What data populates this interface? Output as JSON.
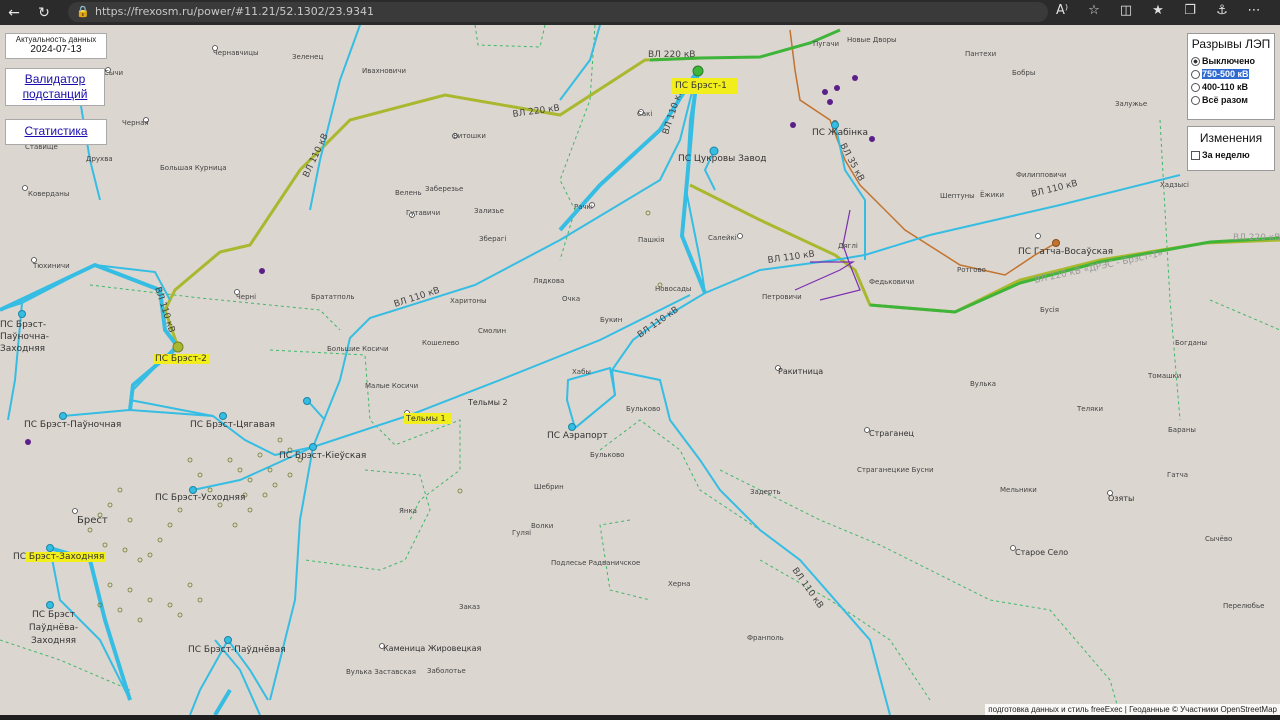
{
  "browser": {
    "url": "https://frexosm.ru/power/#11.21/52.1302/23.9341",
    "icons": [
      "back-arrow-icon",
      "reload-icon",
      "lock-icon",
      "read-aloud-icon",
      "favorite-star-icon",
      "split-screen-icon",
      "favorites-icon",
      "collections-icon",
      "extension-icon",
      "more-icon"
    ]
  },
  "info": {
    "freshness_label": "Актуальность данных",
    "freshness_date": "2024-07-13",
    "validator_link": "Валидатор подстанций",
    "stats_link": "Статистика"
  },
  "legend": {
    "title": "Разрывы ЛЭП",
    "options": [
      "Выключено",
      "750-500 кВ",
      "400-110 кВ",
      "Всё разом"
    ],
    "selected": "Выключено",
    "highlighted": "750-500 кВ"
  },
  "changes": {
    "title": "Изменения",
    "week_label": "За неделю"
  },
  "substations": [
    "ПС Брэст-1",
    "ПС Цукровы Завод",
    "ПС Жабінка",
    "ПС Гатча-Восаўская",
    "ПС Брэст-2",
    "ПС Брэст-Паўночна-Заходняя",
    "ПС Брэст-Паўночная",
    "ПС Брэст-Цягавая",
    "ПС Брэст-Кіеўская",
    "ПС Брэст-Усходняя",
    "ПС Брэст-Заходняя",
    "ПС Брэст Паўднёва-Заходняя",
    "ПС Брэст-Паўднёвая",
    "ПС Аэрапорт",
    "Тельмы 1"
  ],
  "line_labels": [
    "ВЛ 220 кВ",
    "ВЛ 220 кВ",
    "ВЛ 110 кВ",
    "ВЛ 110 кВ",
    "ВЛ 110 кВ",
    "ВЛ 35 кВ",
    "ВЛ 110 кВ",
    "ВЛ 110 кВ",
    "ВЛ 110 кВ",
    "ВЛ 110 кВ",
    "ВЛ 110 кВ",
    "ВЛ 220 кВ «ДРЭС - Брэст-1»",
    "ВЛ 220 кВ «"
  ],
  "places": [
    "Чернавчицы",
    "Зеленец",
    "Ивахновичи",
    "Пугачи",
    "Новые Дворы",
    "Пантехи",
    "Бобры",
    "Залужье",
    "Сычи",
    "Черная",
    "Ставище",
    "Витошки",
    "Сакі",
    "Ракітніца",
    "Друхва",
    "Большая Курница",
    "Коверданы",
    "Велень",
    "Заберезье",
    "Гутавичи",
    "Рачкi",
    "Зализье",
    "Зберагі",
    "Пашкiя",
    "Салейкі",
    "Дяглi",
    "Федьковичи",
    "Ротгово",
    "Тюхиничи",
    "Чернi",
    "Брататполь",
    "Харитоны",
    "Лядкова",
    "Очка",
    "Новосады",
    "Петровичи",
    "Шептуны",
    "Ёжики",
    "Филипповичи",
    "Хадзысі",
    "Бусiя",
    "Богданы",
    "Большие Косичи",
    "Смолин",
    "Кошелево",
    "Букин",
    "Хабы",
    "Ракитница",
    "Вулька",
    "Томашки",
    "Малые Косичи",
    "Тельмы 2",
    "Тельмы 1",
    "Бульково",
    "Теляки",
    "Бараны",
    "Гатча",
    "Страганец",
    "Страганецкие Бусни",
    "Шебрин",
    "Задерть",
    "Мельники",
    "Озяты",
    "Брест",
    "Янка",
    "Гуляі",
    "Волки",
    "Сычёво",
    "Подлесье Радваничское",
    "Старое Село",
    "Херна",
    "Перелюбье",
    "Заказ",
    "Франполь",
    "Каменица Жировецкая",
    "Заболотье",
    "Вулька Заставская",
    "Волкi",
    "Бульково"
  ],
  "attribution": "подготовка данных и стиль freeExec | Геоданные © Участники OpenStreetMap",
  "colors": {
    "map_background": "#dcd6d0",
    "line_110kv": "#35bde3",
    "line_220kv_olive": "#aab82f",
    "line_220kv_green": "#3fb43a",
    "line_35kv": "#c2732e",
    "boundary": "#3fb86a",
    "highlight": "#f1ee1b",
    "purple_marker": "#5b1f8a"
  }
}
